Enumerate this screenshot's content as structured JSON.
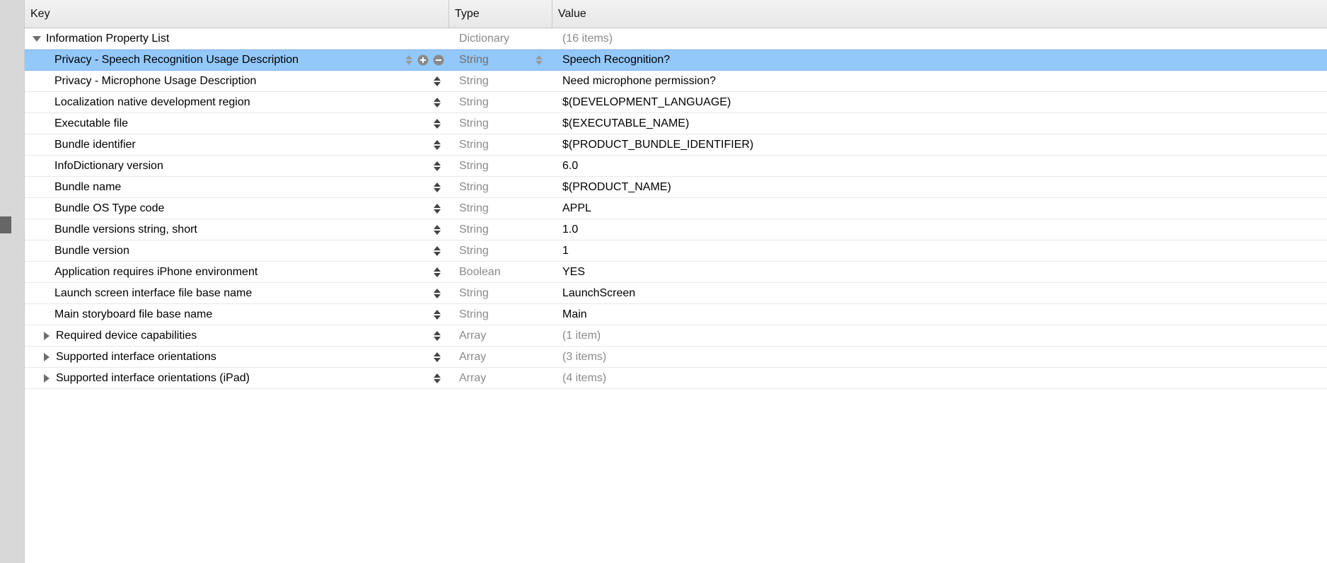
{
  "header": {
    "key": "Key",
    "type": "Type",
    "value": "Value"
  },
  "root": {
    "key": "Information Property List",
    "type": "Dictionary",
    "value": "(16 items)"
  },
  "rows": [
    {
      "key": "Privacy - Speech Recognition Usage Description",
      "type": "String",
      "value": "Speech Recognition?",
      "selected": true
    },
    {
      "key": "Privacy - Microphone Usage Description",
      "type": "String",
      "value": "Need microphone permission?"
    },
    {
      "key": "Localization native development region",
      "type": "String",
      "value": "$(DEVELOPMENT_LANGUAGE)"
    },
    {
      "key": "Executable file",
      "type": "String",
      "value": "$(EXECUTABLE_NAME)"
    },
    {
      "key": "Bundle identifier",
      "type": "String",
      "value": "$(PRODUCT_BUNDLE_IDENTIFIER)"
    },
    {
      "key": "InfoDictionary version",
      "type": "String",
      "value": "6.0"
    },
    {
      "key": "Bundle name",
      "type": "String",
      "value": "$(PRODUCT_NAME)"
    },
    {
      "key": "Bundle OS Type code",
      "type": "String",
      "value": "APPL"
    },
    {
      "key": "Bundle versions string, short",
      "type": "String",
      "value": "1.0"
    },
    {
      "key": "Bundle version",
      "type": "String",
      "value": "1"
    },
    {
      "key": "Application requires iPhone environment",
      "type": "Boolean",
      "value": "YES"
    },
    {
      "key": "Launch screen interface file base name",
      "type": "String",
      "value": "LaunchScreen"
    },
    {
      "key": "Main storyboard file base name",
      "type": "String",
      "value": "Main"
    },
    {
      "key": "Required device capabilities",
      "type": "Array",
      "value": "(1 item)",
      "expandable": true
    },
    {
      "key": "Supported interface orientations",
      "type": "Array",
      "value": "(3 items)",
      "expandable": true
    },
    {
      "key": "Supported interface orientations (iPad)",
      "type": "Array",
      "value": "(4 items)",
      "expandable": true
    }
  ]
}
